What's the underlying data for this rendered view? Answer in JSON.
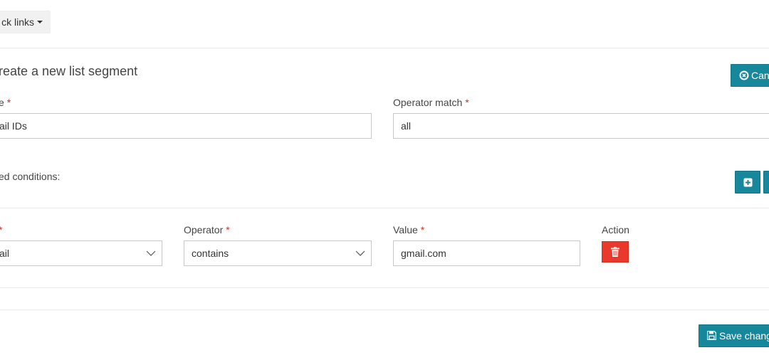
{
  "header": {
    "quick_links_label": "ck links"
  },
  "page": {
    "title": "reate a new list segment",
    "cancel_label": "Canc"
  },
  "form": {
    "name_label": "e",
    "name_value": "ail IDs",
    "operator_match_label": "Operator match",
    "operator_match_value": "all",
    "required_marker": "*"
  },
  "conditions": {
    "heading": "ed conditions:",
    "field_label": "",
    "field_value": "ail",
    "operator_label": "Operator",
    "operator_value": "contains",
    "value_label": "Value",
    "value_value": "gmail.com",
    "action_label": "Action"
  },
  "footer": {
    "save_label": "Save chang"
  },
  "icons": {
    "cancel": "times-circle-icon",
    "add": "plus-square-icon",
    "delete": "trash-icon",
    "save": "floppy-disk-icon",
    "dropdown": "chevron-down-icon"
  },
  "colors": {
    "primary": "#17879b",
    "danger": "#e8392c",
    "required": "#c0392b"
  }
}
